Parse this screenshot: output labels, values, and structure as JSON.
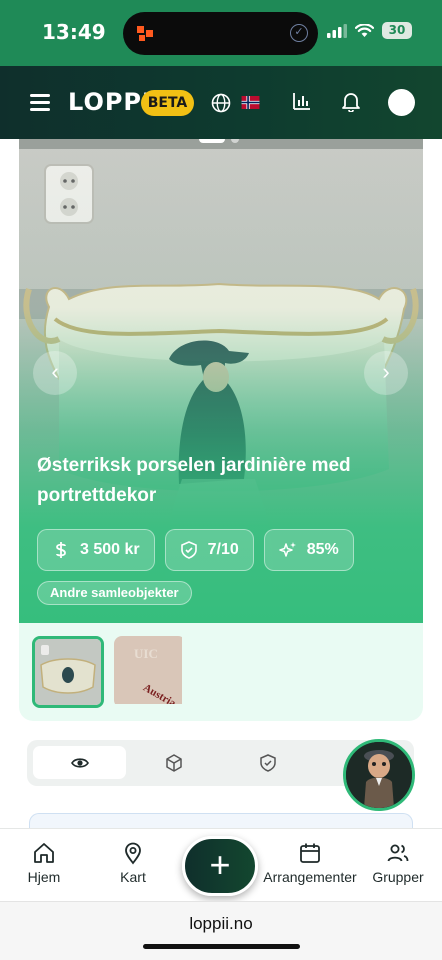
{
  "status_bar": {
    "time": "13:49",
    "battery": "30"
  },
  "header": {
    "logo": "LOPPII",
    "badge": "BETA"
  },
  "listing": {
    "title": "Østerriksk porselen jardinière med portrettdekor",
    "price": "3 500 kr",
    "condition": "7/10",
    "match": "85%",
    "category": "Andre samleobjekter",
    "thumbnail_text": "Austria"
  },
  "bottom_nav": {
    "items": [
      {
        "label": "Hjem",
        "icon": "home-icon"
      },
      {
        "label": "Kart",
        "icon": "map-pin-icon"
      },
      {
        "label": "Arrangementer",
        "icon": "calendar-icon"
      },
      {
        "label": "Grupper",
        "icon": "users-icon"
      }
    ],
    "fab_label": "+"
  },
  "browser": {
    "url": "loppii.no"
  },
  "colors": {
    "brand_green": "#1f8a57",
    "header_dark": "#0f2f2c",
    "accent_green": "#2fb978",
    "badge_yellow": "#f2c014"
  }
}
